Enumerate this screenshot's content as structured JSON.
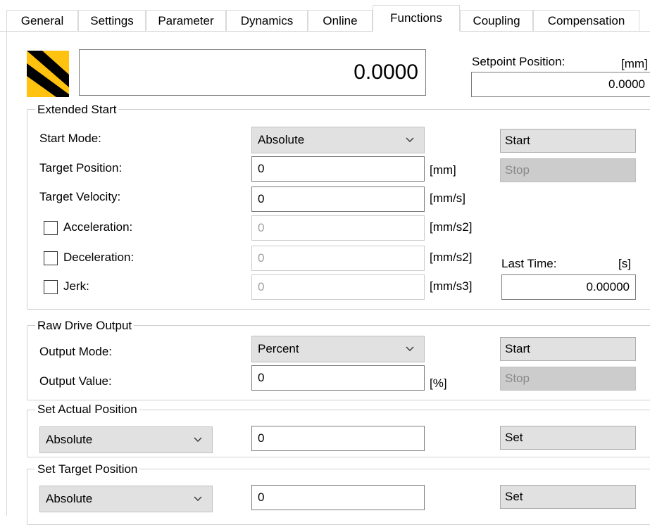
{
  "tabs": [
    "General",
    "Settings",
    "Parameter",
    "Dynamics",
    "Online",
    "Functions",
    "Coupling",
    "Compensation"
  ],
  "active_tab": "Functions",
  "status_icon": "axis-status-hazard-icon",
  "colors": {
    "hazard_yellow": "#ffc20e",
    "hazard_black": "#000000"
  },
  "position_display": {
    "value": "0.0000"
  },
  "setpoint": {
    "label": "Setpoint Position:",
    "unit": "[mm]",
    "value": "0.0000"
  },
  "extended_start": {
    "title": "Extended Start",
    "start_mode": {
      "label": "Start Mode:",
      "value": "Absolute"
    },
    "target_position": {
      "label": "Target Position:",
      "value": "0",
      "unit": "[mm]"
    },
    "target_velocity": {
      "label": "Target Velocity:",
      "value": "0",
      "unit": "[mm/s]"
    },
    "acceleration": {
      "label": "Acceleration:",
      "value": "0",
      "unit": "[mm/s2]"
    },
    "deceleration": {
      "label": "Deceleration:",
      "value": "0",
      "unit": "[mm/s2]"
    },
    "jerk": {
      "label": "Jerk:",
      "value": "0",
      "unit": "[mm/s3]"
    },
    "start_label": "Start",
    "stop_label": "Stop",
    "last_time": {
      "label": "Last Time:",
      "unit": "[s]",
      "value": "0.00000"
    }
  },
  "raw_drive_output": {
    "title": "Raw Drive Output",
    "output_mode": {
      "label": "Output Mode:",
      "value": "Percent"
    },
    "output_value": {
      "label": "Output Value:",
      "value": "0",
      "unit": "[%]"
    },
    "start_label": "Start",
    "stop_label": "Stop"
  },
  "set_actual_position": {
    "title": "Set Actual Position",
    "mode": "Absolute",
    "value": "0",
    "set_label": "Set"
  },
  "set_target_position": {
    "title": "Set Target Position",
    "mode": "Absolute",
    "value": "0",
    "set_label": "Set"
  }
}
